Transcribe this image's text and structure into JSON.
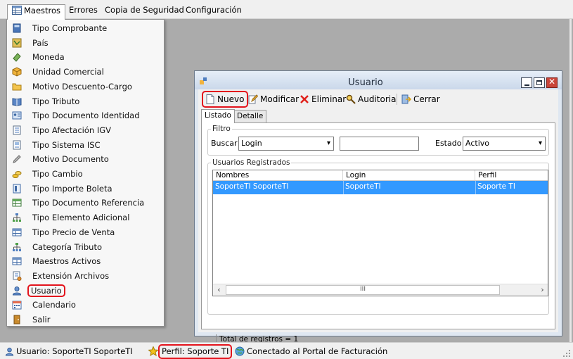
{
  "menubar": {
    "items": [
      {
        "label": "Maestros"
      },
      {
        "label": "Errores"
      },
      {
        "label": "Copia de Seguridad"
      },
      {
        "label": "Configuración"
      }
    ]
  },
  "dropdown": {
    "items": [
      {
        "label": "Tipo Comprobante",
        "icon": "book-icon"
      },
      {
        "label": "País",
        "icon": "map-icon"
      },
      {
        "label": "Moneda",
        "icon": "money-icon"
      },
      {
        "label": "Unidad Comercial",
        "icon": "box-icon"
      },
      {
        "label": "Motivo Descuento-Cargo",
        "icon": "folder-icon"
      },
      {
        "label": "Tipo Tributo",
        "icon": "book-open-icon"
      },
      {
        "label": "Tipo Documento Identidad",
        "icon": "id-card-icon"
      },
      {
        "label": "Tipo Afectación IGV",
        "icon": "document-icon"
      },
      {
        "label": "Tipo Sistema ISC",
        "icon": "document-icon"
      },
      {
        "label": "Motivo Documento",
        "icon": "pencil-icon"
      },
      {
        "label": "Tipo Cambio",
        "icon": "coins-icon"
      },
      {
        "label": "Tipo Importe Boleta",
        "icon": "receipt-icon"
      },
      {
        "label": "Tipo Documento Referencia",
        "icon": "spreadsheet-icon"
      },
      {
        "label": "Tipo Elemento Adicional",
        "icon": "hierarchy-icon"
      },
      {
        "label": "Tipo Precio de Venta",
        "icon": "spreadsheet-icon"
      },
      {
        "label": "Categoría Tributo",
        "icon": "hierarchy-icon"
      },
      {
        "label": "Maestros Activos",
        "icon": "table-icon"
      },
      {
        "label": "Extensión Archivos",
        "icon": "document-settings-icon"
      },
      {
        "label": "Usuario",
        "icon": "user-icon"
      },
      {
        "label": "Calendario",
        "icon": "calendar-icon"
      },
      {
        "label": "Salir",
        "icon": "exit-icon"
      }
    ]
  },
  "window": {
    "title": "Usuario",
    "toolbar": {
      "nuevo": "Nuevo",
      "modificar": "Modificar",
      "eliminar": "Eliminar",
      "auditoria": "Auditoria",
      "cerrar": "Cerrar"
    },
    "tabs": [
      {
        "label": "Listado",
        "active": true
      },
      {
        "label": "Detalle",
        "active": false
      }
    ],
    "filtro": {
      "legend": "Filtro",
      "buscar_label": "Buscar",
      "buscar_field": "Login",
      "search_value": "",
      "estado_label": "Estado",
      "estado_value": "Activo"
    },
    "usuarios": {
      "legend": "Usuarios Registrados",
      "columns": [
        "Nombres",
        "Login",
        "Perfil"
      ],
      "rows": [
        {
          "nombres": "SoporteTI SoporteTI",
          "login": "SoporteTI",
          "perfil": "Soporte TI"
        }
      ],
      "scroll_thumb": "III"
    },
    "total": "Total de registros = 1"
  },
  "statusbar": {
    "usuario": "Usuario: SoporteTI SoporteTI",
    "perfil": "Perfil: Soporte TI",
    "conexion": "Conectado al Portal de Facturación"
  },
  "colors": {
    "highlight_red": "#e3131c",
    "selection_blue": "#3399ff",
    "mdi_background": "#ababab"
  }
}
